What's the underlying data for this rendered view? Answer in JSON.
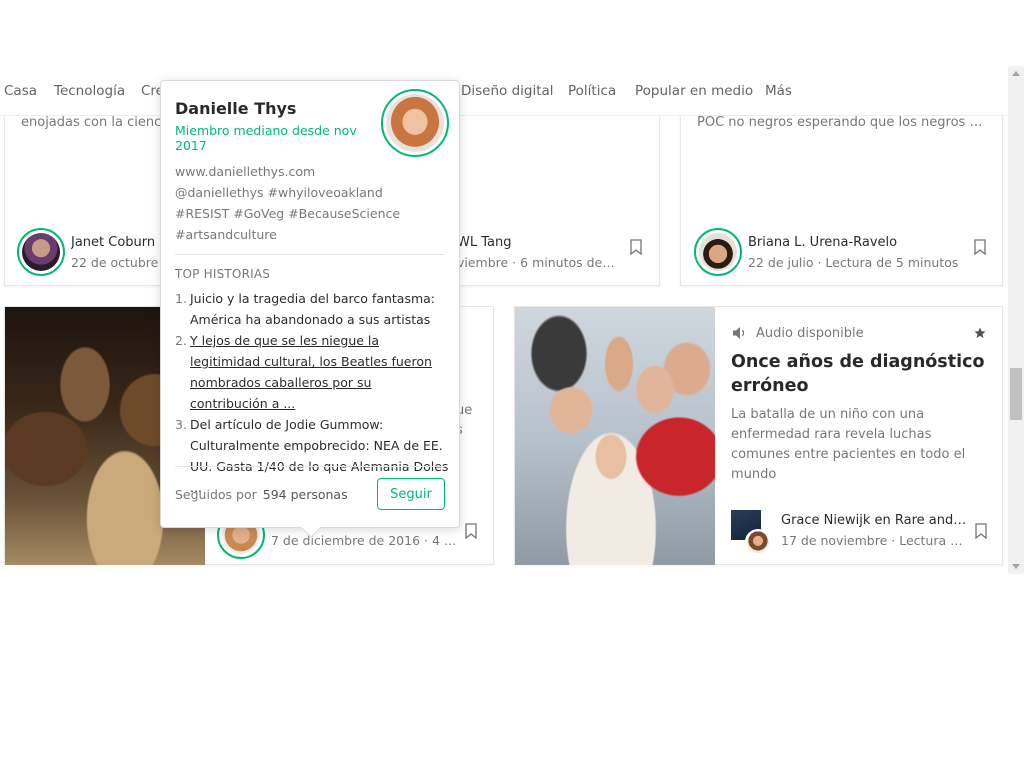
{
  "nav": {
    "items": [
      "Casa",
      "Tecnología",
      "Cre",
      "Diseño digital",
      "Política",
      "Popular en medio",
      "Más"
    ]
  },
  "cards_top": [
    {
      "snippet": "enojadas con la ciencia",
      "author": "Janet Coburn",
      "meta": "22 de octubre ·"
    },
    {
      "snippet": "",
      "author": "WL Tang",
      "meta": "viembre · 6 minutos de l..."
    },
    {
      "snippet": "POC no negros esperando que los negros y l...",
      "author": "Briana L. Urena-Ravelo",
      "meta": "22 de julio · Lectura de 5 minutos"
    }
  ],
  "card_bottom_left": {
    "partial_text": [
      "ue",
      "s"
    ],
    "meta": "7 de diciembre de 2016 · 4 m..."
  },
  "feature_card": {
    "audio_label": "Audio disponible",
    "title": "Once años de diagnóstico erróneo",
    "subtitle": "La batalla de un niño con una enfermedad rara revela luchas comunes entre pacientes en todo el mundo",
    "author": "Grace Niewijk en Rare and O...",
    "meta": "17 de noviembre · Lectura d..."
  },
  "popover": {
    "name": "Danielle Thys",
    "member_since": "Miembro mediano desde nov 2017",
    "bio_lines": [
      "www.daniellethys.com",
      "@daniellethys #whyiloveoakland",
      "#RESIST #GoVeg #BecauseScience",
      "#artsandculture"
    ],
    "top_label": "TOP HISTORIAS",
    "top_stories": [
      {
        "num": "1.",
        "text": "Juicio y la tragedia del barco fantasma: América ha abandonado a sus artistas"
      },
      {
        "num": "2.",
        "text": "Y lejos de que se les niegue la legitimidad cultural, los Beatles fueron nombrados caballeros por su contribución a ..."
      },
      {
        "num": "3.",
        "text": "Del artículo de Jodie Gummow: Culturalmente empobrecido: NEA de EE. UU. Gasta 1/40 de lo que Alemania Doles ..."
      }
    ],
    "followers_label": "Seguidos por",
    "followers_count": "594 personas",
    "follow_button": "Seguir"
  },
  "colors": {
    "accent": "#02b875"
  }
}
